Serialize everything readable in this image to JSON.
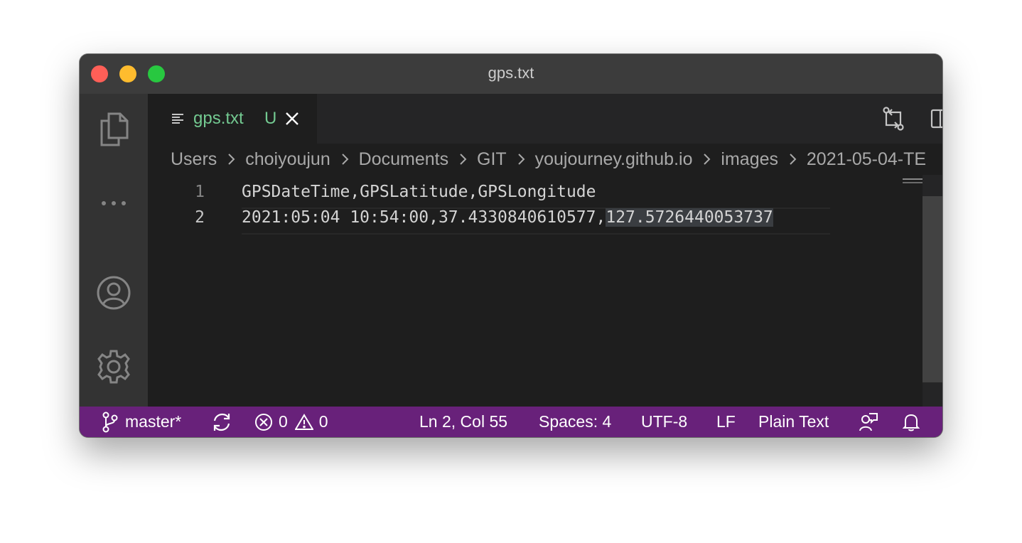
{
  "window": {
    "title": "gps.txt"
  },
  "activity_bar": {
    "icons": [
      "files-icon",
      "more-icon",
      "account-icon",
      "settings-gear-icon"
    ]
  },
  "tab": {
    "name": "gps.txt",
    "status": "U"
  },
  "breadcrumb": [
    "Users",
    "choiyoujun",
    "Documents",
    "GIT",
    "youjourney.github.io",
    "images",
    "2021-05-04-TE"
  ],
  "editor": {
    "lines": [
      {
        "number": "1",
        "text": "GPSDateTime,GPSLatitude,GPSLongitude"
      },
      {
        "number": "2",
        "text_before": "2021:05:04 10:54:00,37.4330840610577,",
        "text_selected": "127.5726440053737"
      }
    ]
  },
  "statusbar": {
    "branch": "master*",
    "errors": "0",
    "warnings": "0",
    "position": "Ln 2, Col 55",
    "indent": "Spaces: 4",
    "encoding": "UTF-8",
    "eol": "LF",
    "language": "Plain Text"
  },
  "colors": {
    "statusbar": "#68217a",
    "untracked": "#73c991",
    "editor_bg": "#1e1e1e"
  }
}
